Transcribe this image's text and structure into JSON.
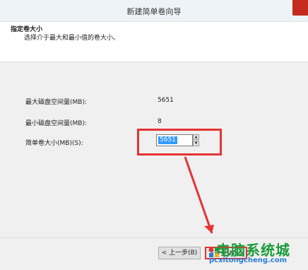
{
  "window": {
    "title": "新建简单卷向导"
  },
  "header": {
    "title": "指定卷大小",
    "subtitle": "选择介于最大和最小值的卷大小。"
  },
  "fields": [
    {
      "label": "最大磁盘空间量(MB):",
      "value": "5651"
    },
    {
      "label": "最小磁盘空间量(MB):",
      "value": "8"
    }
  ],
  "size_field": {
    "label": "简单卷大小(MB)(S):",
    "value": "5651"
  },
  "buttons": {
    "back": "< 上一步(B)",
    "next": "下一步(N) >"
  },
  "watermark": {
    "text": "电脑系统城",
    "url": "pcxitongcheng.com"
  },
  "colors": {
    "highlight": "#e53333",
    "selection": "#3399ff",
    "watermark": "#1b9b3a"
  }
}
